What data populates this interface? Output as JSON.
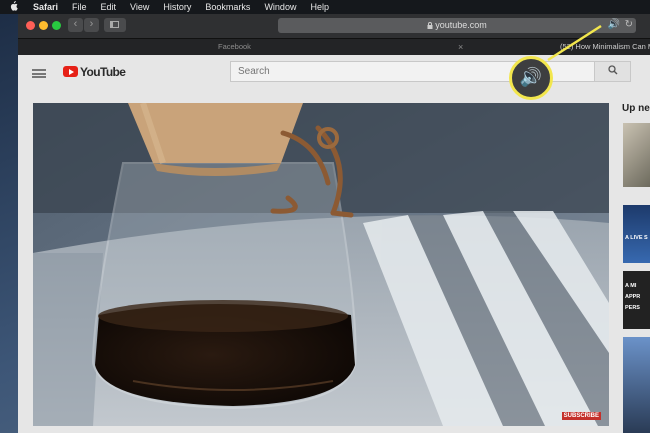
{
  "menubar": {
    "app": "Safari",
    "items": [
      "File",
      "Edit",
      "View",
      "History",
      "Bookmarks",
      "Window",
      "Help"
    ]
  },
  "toolbar": {
    "back_glyph": "‹",
    "forward_glyph": "›"
  },
  "address_bar": {
    "lock_icon": "lock-icon",
    "url": "youtube.com",
    "audio_icon": "speaker-icon",
    "audio_glyph": "🔊",
    "reload_glyph": "↻"
  },
  "tabs": [
    {
      "label": "Facebook"
    },
    {
      "label": "(52) How Minimalism Can M"
    }
  ],
  "tab_close_glyph": "×",
  "youtube": {
    "logo_text": "YouTube",
    "search_placeholder": "Search",
    "search_icon": "⚲",
    "subscribe_badge": "SUBSCRIBE",
    "up_next_label": "Up ne",
    "thumb_live_text": "A LIVE S",
    "thumb_text_lines": [
      "A MI",
      "APPR",
      "PERS"
    ]
  },
  "highlight": {
    "color": "#f2e64d",
    "icon": "speaker-icon",
    "glyph": "🔊"
  },
  "colors": {
    "accent_blue": "#4fa3ff",
    "youtube_red": "#e62117"
  }
}
